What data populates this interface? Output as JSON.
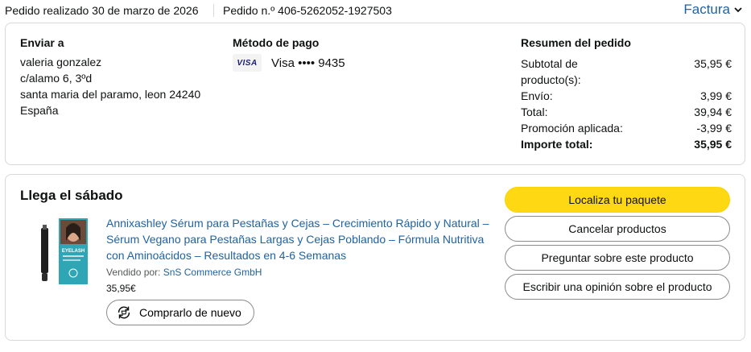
{
  "header": {
    "order_placed": "Pedido realizado 30 de marzo de 2026",
    "order_number": "Pedido n.º 406-5262052-1927503",
    "invoice_label": "Factura"
  },
  "shipping": {
    "title": "Enviar a",
    "lines": [
      "valeria gonzalez",
      "c/alamo 6, 3ºd",
      "santa maria del paramo, leon 24240",
      "España"
    ]
  },
  "payment": {
    "title": "Método de pago",
    "card_brand": "VISA",
    "card_text": "Visa •••• 9435"
  },
  "summary": {
    "title": "Resumen del pedido",
    "rows": [
      {
        "label": "Subtotal de producto(s):",
        "value": "35,95 €"
      },
      {
        "label": "Envío:",
        "value": "3,99 €"
      },
      {
        "label": "Total:",
        "value": "39,94 €"
      },
      {
        "label": "Promoción aplicada:",
        "value": "-3,99 €"
      },
      {
        "label": "Importe total:",
        "value": "35,95 €"
      }
    ]
  },
  "delivery": {
    "title": "Llega el sábado",
    "product_title": "Annixashley Sérum para Pestañas y Cejas – Crecimiento Rápido y Natural – Sérum Vegano para Pestañas Largas y Cejas Poblando – Fórmula Nutritiva con Aminoácidos – Resultados en 4-6 Semanas",
    "sold_by_label": "Vendido por:",
    "seller": "SnS Commerce GmbH",
    "price": "35,95€",
    "image_text": "EYELASH",
    "rebuy_label": "Comprarlo de nuevo"
  },
  "actions": {
    "track": "Localiza tu paquete",
    "cancel": "Cancelar productos",
    "ask": "Preguntar sobre este producto",
    "review": "Escribir una opinión sobre el producto"
  },
  "colors": {
    "link": "#2162a1",
    "primary_button": "#ffd814",
    "border": "#d5d9d9"
  },
  "icons": [
    "chevron-down-icon",
    "visa-logo",
    "rebuy-icon"
  ]
}
